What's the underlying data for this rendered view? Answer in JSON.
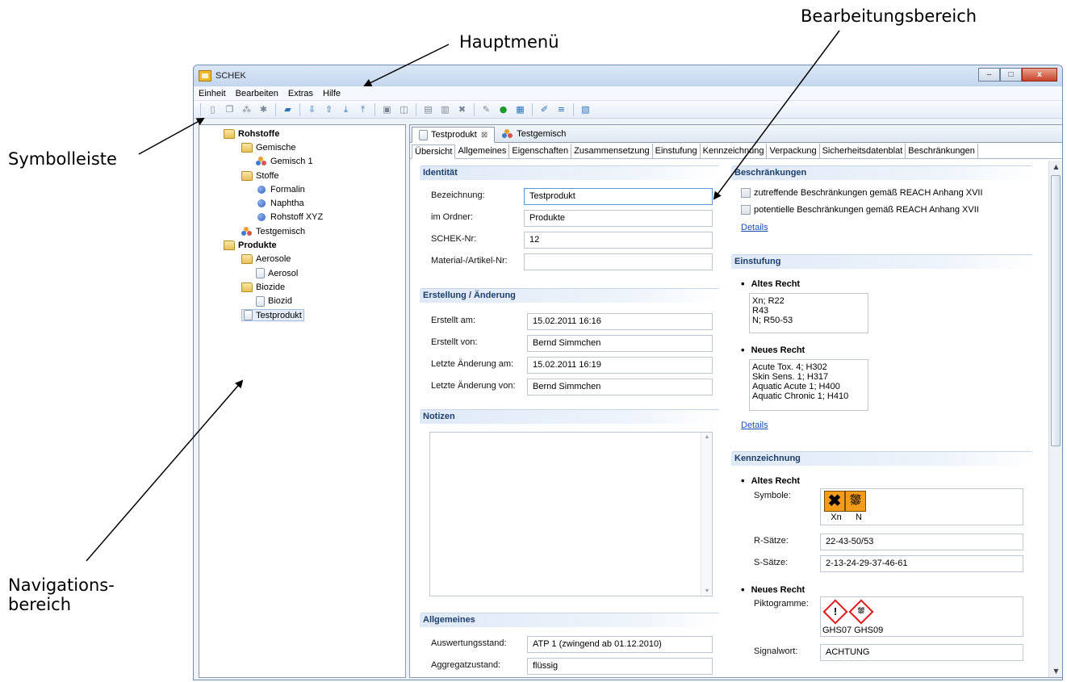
{
  "annotations": {
    "hauptmenue": "Hauptmenü",
    "bearbeitungsbereich": "Bearbeitungsbereich",
    "symbolleiste": "Symbolleiste",
    "navigation_line1": "Navigations-",
    "navigation_line2": "bereich"
  },
  "window": {
    "title": "SCHEK",
    "controls": {
      "minimize": "–",
      "maximize": "□",
      "close": "x"
    }
  },
  "menu": [
    "Einheit",
    "Bearbeiten",
    "Extras",
    "Hilfe"
  ],
  "toolbar_icons": [
    "new-icon",
    "copy-icon",
    "mix-icon",
    "settings-icon",
    "folder-icon",
    "import-icon",
    "export-icon",
    "import-tray-icon",
    "export-tray-icon",
    "save-icon",
    "save-all-icon",
    "copy-doc-icon",
    "paste-icon",
    "delete-icon",
    "edit-icon",
    "run-icon",
    "calculator-icon",
    "wand-icon",
    "report-icon",
    "document-icon"
  ],
  "tree": {
    "rohstoffe": "Rohstoffe",
    "gemische": "Gemische",
    "gemisch1": "Gemisch 1",
    "stoffe": "Stoffe",
    "formalin": "Formalin",
    "naphtha": "Naphtha",
    "rohstoff_xyz": "Rohstoff XYZ",
    "testgemisch": "Testgemisch",
    "produkte": "Produkte",
    "aerosole": "Aerosole",
    "aerosol": "Aerosol",
    "biozide": "Biozide",
    "biozid": "Biozid",
    "testprodukt": "Testprodukt"
  },
  "editor_tabs": {
    "tab1": "Testprodukt",
    "tab2": "Testgemisch"
  },
  "sub_tabs": [
    "Übersicht",
    "Allgemeines",
    "Eigenschaften",
    "Zusammensetzung",
    "Einstufung",
    "Kennzeichnung",
    "Verpackung",
    "Sicherheitsdatenblat",
    "Beschränkungen"
  ],
  "identitaet": {
    "title": "Identität",
    "bezeichnung_label": "Bezeichnung:",
    "bezeichnung": "Testprodukt",
    "ordner_label": "im Ordner:",
    "ordner": "Produkte",
    "schek_label": "SCHEK-Nr:",
    "schek": "12",
    "material_label": "Material-/Artikel-Nr:",
    "material": ""
  },
  "erstellung": {
    "title": "Erstellung / Änderung",
    "erstellt_am_label": "Erstellt am:",
    "erstellt_am": "15.02.2011 16:16",
    "erstellt_von_label": "Erstellt von:",
    "erstellt_von": "Bernd Simmchen",
    "letzte_am_label": "Letzte Änderung am:",
    "letzte_am": "15.02.2011 16:19",
    "letzte_von_label": "Letzte Änderung von:",
    "letzte_von": "Bernd Simmchen"
  },
  "notizen": {
    "title": "Notizen",
    "text": ""
  },
  "allgemeines": {
    "title": "Allgemeines",
    "auswertung_label": "Auswertungsstand:",
    "auswertung": "ATP 1 (zwingend ab 01.12.2010)",
    "aggregat_label": "Aggregatzustand:",
    "aggregat": "flüssig"
  },
  "beschraenkungen": {
    "title": "Beschränkungen",
    "check1": "zutreffende Beschränkungen gemäß REACH Anhang XVII",
    "check2": "potentielle Beschränkungen gemäß REACH Anhang XVII",
    "details": "Details"
  },
  "einstufung": {
    "title": "Einstufung",
    "altes_recht": "Altes Recht",
    "altes": [
      "Xn; R22",
      "R43",
      "N; R50-53"
    ],
    "neues_recht": "Neues Recht",
    "neues": [
      "Acute Tox. 4; H302",
      "Skin Sens. 1; H317",
      "Aquatic Acute 1; H400",
      "Aquatic Chronic 1; H410"
    ],
    "details": "Details"
  },
  "kennzeichnung": {
    "title": "Kennzeichnung",
    "altes_recht": "Altes Recht",
    "symbole_label": "Symbole:",
    "sym1": "Xn",
    "sym2": "N",
    "rsaetze_label": "R-Sätze:",
    "rsaetze": "22-43-50/53",
    "ssaetze_label": "S-Sätze:",
    "ssaetze": "2-13-24-29-37-46-61",
    "neues_recht": "Neues Recht",
    "pikto_label": "Piktogramme:",
    "pikto": "GHS07 GHS09",
    "signal_label": "Signalwort:",
    "signal": "ACHTUNG"
  },
  "colors": {
    "section_title": "#1e3e6a",
    "link": "#1a4fb5",
    "ghs_red": "#e01818",
    "hazard_orange": "#f39c1a"
  }
}
